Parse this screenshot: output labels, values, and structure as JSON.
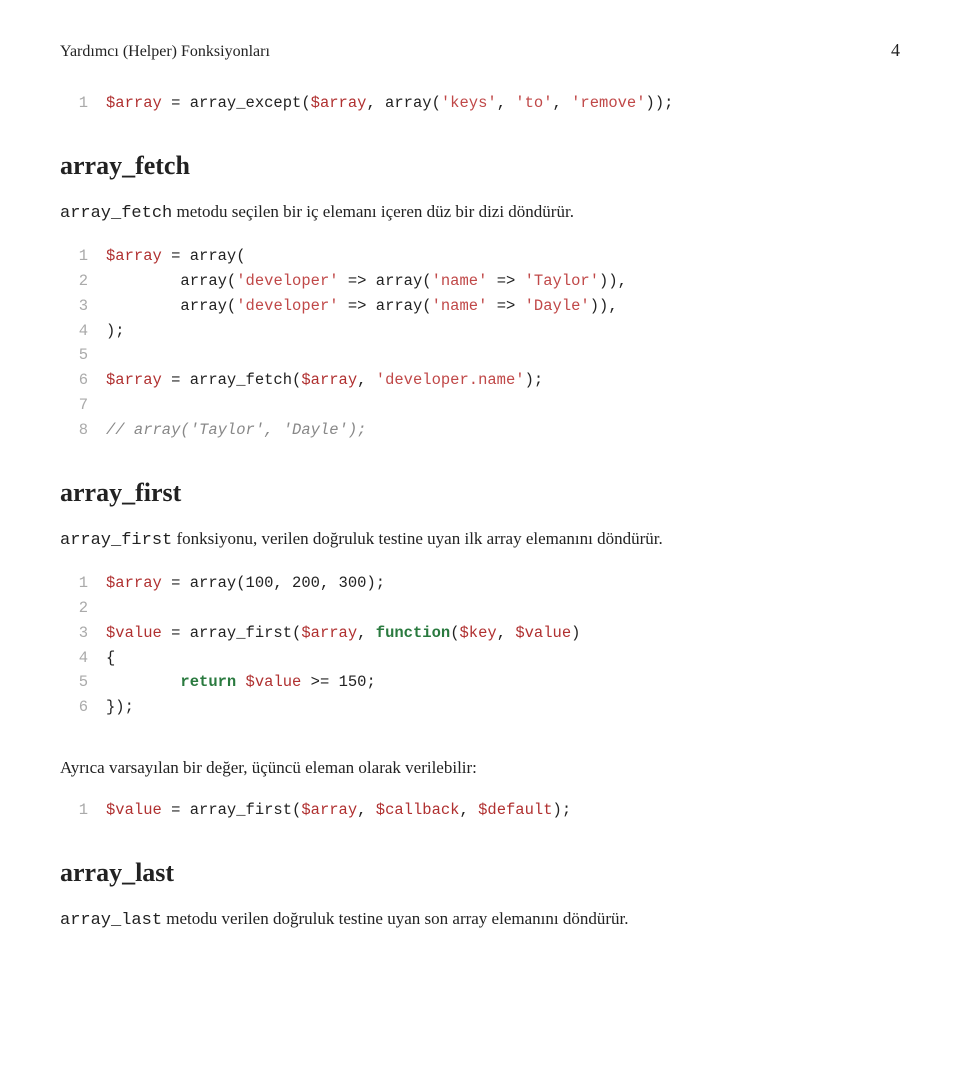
{
  "header": {
    "title": "Yardımcı (Helper) Fonksiyonları",
    "page": "4"
  },
  "code1": {
    "lines": [
      {
        "n": "1",
        "html": "<span class='var'>$array</span> = array_except(<span class='var'>$array</span>, array(<span class='str'>'keys'</span>, <span class='str'>'to'</span>, <span class='str'>'remove'</span>));"
      }
    ]
  },
  "section_fetch": {
    "title": "array_fetch",
    "desc_prefix": "array_fetch",
    "desc_rest": " metodu seçilen bir iç elemanı içeren düz bir dizi döndürür."
  },
  "code2": {
    "lines": [
      {
        "n": "1",
        "html": "<span class='var'>$array</span> = array("
      },
      {
        "n": "2",
        "html": "        array(<span class='str'>'developer'</span> =&gt; array(<span class='str'>'name'</span> =&gt; <span class='str'>'Taylor'</span>)),"
      },
      {
        "n": "3",
        "html": "        array(<span class='str'>'developer'</span> =&gt; array(<span class='str'>'name'</span> =&gt; <span class='str'>'Dayle'</span>)),"
      },
      {
        "n": "4",
        "html": ");"
      },
      {
        "n": "5",
        "html": ""
      },
      {
        "n": "6",
        "html": "<span class='var'>$array</span> = array_fetch(<span class='var'>$array</span>, <span class='str'>'developer.name'</span>);"
      },
      {
        "n": "7",
        "html": ""
      },
      {
        "n": "8",
        "html": "<span class='cmt'>// array('Taylor', 'Dayle');</span>"
      }
    ]
  },
  "section_first": {
    "title": "array_first",
    "desc_prefix": "array_first",
    "desc_rest": " fonksiyonu, verilen doğruluk testine uyan ilk array elemanını döndürür."
  },
  "code3": {
    "lines": [
      {
        "n": "1",
        "html": "<span class='var'>$array</span> = array(100, 200, 300);"
      },
      {
        "n": "2",
        "html": ""
      },
      {
        "n": "3",
        "html": "<span class='var'>$value</span> = array_first(<span class='var'>$array</span>, <span class='kw'>function</span>(<span class='var'>$key</span>, <span class='var'>$value</span>)"
      },
      {
        "n": "4",
        "html": "{"
      },
      {
        "n": "5",
        "html": "        <span class='kw'>return</span> <span class='var'>$value</span> &gt;= 150;"
      },
      {
        "n": "6",
        "html": "});"
      }
    ]
  },
  "desc_default": "Ayrıca varsayılan bir değer, üçüncü eleman olarak verilebilir:",
  "code4": {
    "lines": [
      {
        "n": "1",
        "html": "<span class='var'>$value</span> = array_first(<span class='var'>$array</span>, <span class='var'>$callback</span>, <span class='var'>$default</span>);"
      }
    ]
  },
  "section_last": {
    "title": "array_last",
    "desc_prefix": "array_last",
    "desc_rest": " metodu verilen doğruluk testine uyan son array elemanını döndürür."
  }
}
